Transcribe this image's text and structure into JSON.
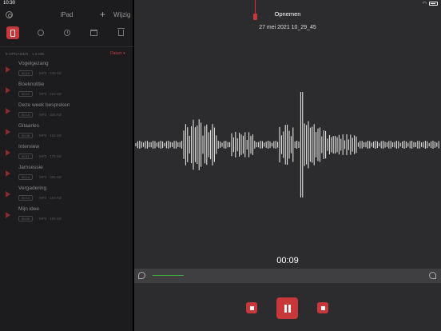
{
  "status": {
    "time": "10:30"
  },
  "sidebar": {
    "title": "iPad",
    "add_label": "+",
    "edit_label": "Wijzig",
    "list_meta": "8 OPNAMEN · 1.6 MB",
    "sort_label": "Datum ▾",
    "recordings": [
      {
        "name": "Vogelgezang",
        "duration": "00:10",
        "info": "MP3 · 246 KB"
      },
      {
        "name": "Boeknotitie",
        "duration": "00:12",
        "info": "MP3 · 224 KB"
      },
      {
        "name": "Deze week bespreken",
        "duration": "00:15",
        "info": "MP3 · 326 KB"
      },
      {
        "name": "Gitaarles",
        "duration": "00:08",
        "info": "MP3 · 152 KB"
      },
      {
        "name": "Interview",
        "duration": "00:11",
        "info": "MP3 · 176 KB"
      },
      {
        "name": "Jamsessie",
        "duration": "00:14",
        "info": "MP3 · 306 KB"
      },
      {
        "name": "Vergadering",
        "duration": "00:13",
        "info": "MP3 · 224 KB"
      },
      {
        "name": "Mijn idee",
        "duration": "00:09",
        "info": "MP3 · 180 KB"
      }
    ]
  },
  "main": {
    "title": "Opnemen",
    "date": "27 mei 2021 10_29_45",
    "timer": "00:09"
  },
  "colors": {
    "accent": "#c8383b",
    "progress": "#3fae43"
  }
}
